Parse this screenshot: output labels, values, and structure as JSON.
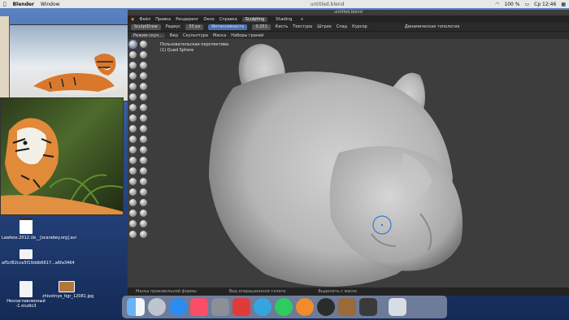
{
  "menubar": {
    "app": "Blender",
    "menu_window": "Window",
    "file": "untitled.blend",
    "battery": "100 %",
    "clock": "Ср 12:46"
  },
  "blender": {
    "menu": [
      "Файл",
      "Правка",
      "Рендеринг",
      "Окно",
      "Справка"
    ],
    "workspace_active": "Sculpting",
    "workspace_next": "Shading",
    "tool": "SculptDraw",
    "radius_label": "Радиус",
    "radius_value": "33 px",
    "strength_label": "Интенсивность",
    "strength_value": "0.251",
    "brush_menu": "Кисть",
    "texture_menu": "Текстура",
    "stroke_menu": "Штрих",
    "falloff_menu": "Спад",
    "cursor_menu": "Курсор",
    "dynamic_topology": "Динамическая топология",
    "mode": "Режим скул...",
    "view_menu": "Вид",
    "sculpt_menu": "Скульптура",
    "mask_menu": "Маска",
    "face_sets_menu": "Наборы граней",
    "viewport_label": "Пользовательская перспектива",
    "object_label": "(1) Quad Sphere",
    "status": [
      "Маска произвольной формы",
      "Вид операционной телеги",
      "Выделить с масок"
    ]
  },
  "desktop": {
    "icons": [
      {
        "label": "Lawless.2012.Ue__[scarabey.org].avi"
      },
      {
        "label": "af5cf82cce5f19ddb6617...a6fa3464"
      },
      {
        "label": "Неозаглавленный -1.studio3"
      },
      {
        "label": "zhivotnye_tigr_12081.jpg"
      }
    ]
  },
  "dock": {
    "apps": [
      "finder-icon",
      "launchpad-icon",
      "safari-icon",
      "music-icon",
      "system-preferences-icon",
      "affinity-icon",
      "telegram-icon",
      "whatsapp-icon",
      "blender-icon",
      "pixelmator-icon",
      "preview-icon",
      "screenshot-icon",
      "trash-icon"
    ]
  }
}
